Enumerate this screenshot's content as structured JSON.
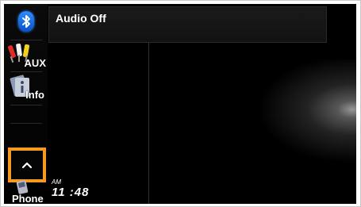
{
  "header": {
    "title": "Audio Off"
  },
  "sidebar": {
    "items": [
      {
        "id": "bluetooth",
        "label": "",
        "icon": "bluetooth-icon"
      },
      {
        "id": "aux",
        "label": "AUX",
        "icon": "rca-plug-icon"
      },
      {
        "id": "info",
        "label": "Info",
        "icon": "info-icon"
      },
      {
        "id": "up",
        "label": "^",
        "icon": "chevron-up-icon"
      },
      {
        "id": "phone",
        "label": "Phone",
        "icon": "phone-icon"
      }
    ],
    "highlight_color": "#f79a1d"
  },
  "clock": {
    "ampm": "AM",
    "time": "11 :48"
  },
  "colors": {
    "background": "#000000",
    "text": "#ffffff",
    "bluetooth": "#1e6fe8"
  }
}
